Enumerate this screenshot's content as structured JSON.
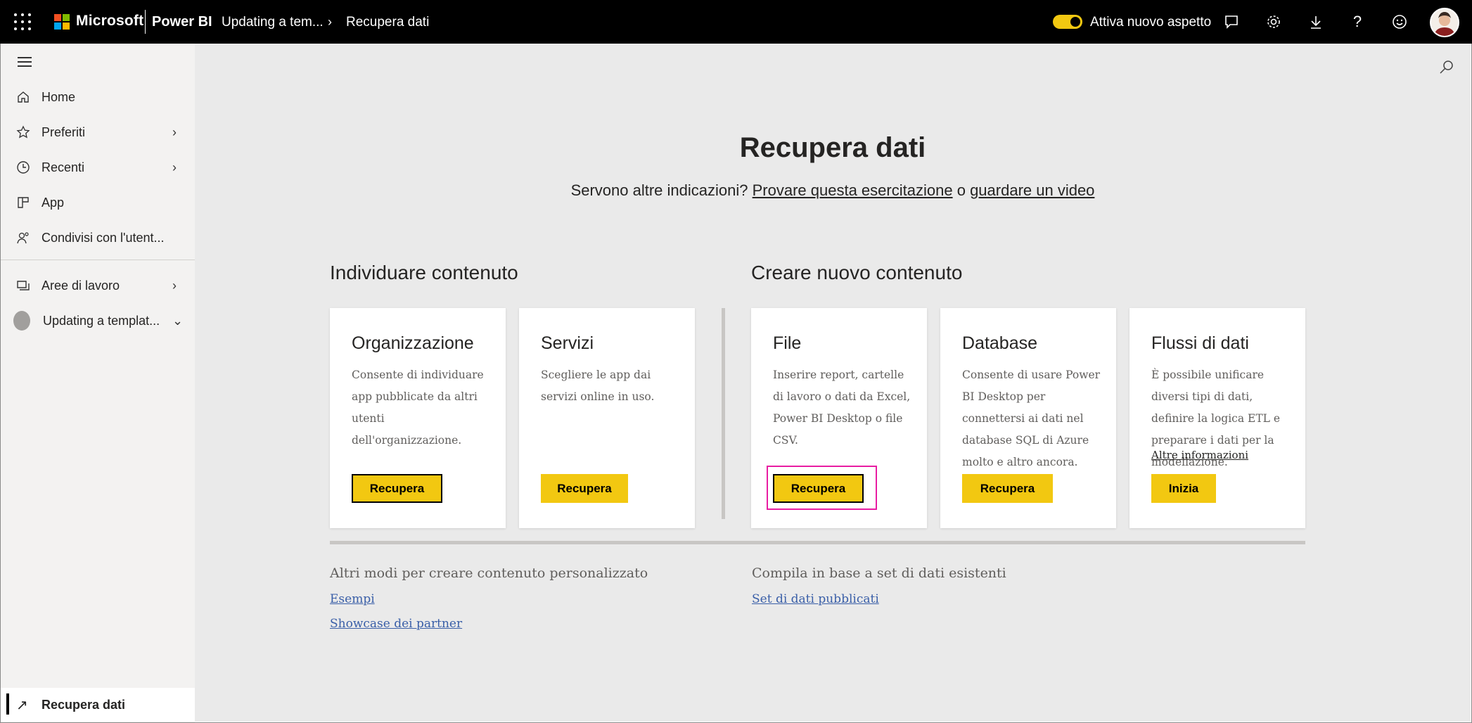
{
  "topbar": {
    "brand": "Microsoft",
    "product": "Power BI",
    "breadcrumb": [
      "Updating a tem...",
      "Recupera dati"
    ],
    "toggle_label": "Attiva nuovo aspetto",
    "toggle_on": true,
    "icons": [
      "app-launcher-icon",
      "feedback-icon",
      "settings-icon",
      "download-icon",
      "help-icon",
      "smiley-icon",
      "user-avatar"
    ]
  },
  "sidebar": {
    "items": [
      {
        "label": "Home",
        "icon": "home-icon"
      },
      {
        "label": "Preferiti",
        "icon": "star-icon",
        "chevron": "right"
      },
      {
        "label": "Recenti",
        "icon": "clock-icon",
        "chevron": "right"
      },
      {
        "label": "App",
        "icon": "apps-icon"
      },
      {
        "label": "Condivisi con l'utent...",
        "icon": "shared-icon"
      },
      {
        "label": "Aree di lavoro",
        "icon": "workspaces-icon",
        "chevron": "right"
      },
      {
        "label": "Updating a templat...",
        "icon": "workspace-badge",
        "chevron": "down"
      }
    ],
    "bottom": {
      "label": "Recupera dati",
      "icon": "arrow-up-right-icon"
    }
  },
  "main": {
    "title": "Recupera dati",
    "subtitle_prefix": "Servono altre indicazioni?",
    "subtitle_link1": "Provare questa esercitazione",
    "subtitle_mid": "o",
    "subtitle_link2": "guardare un video",
    "section_discover": "Individuare contenuto",
    "section_create": "Creare nuovo contenuto",
    "cards": [
      {
        "title": "Organizzazione",
        "desc": "Consente di individuare app pubblicate da altri utenti dell'organizzazione.",
        "button": "Recupera"
      },
      {
        "title": "Servizi",
        "desc": "Scegliere le app dai servizi online in uso.",
        "button": "Recupera"
      },
      {
        "title": "File",
        "desc": "Inserire report, cartelle di lavoro o dati da Excel, Power BI Desktop o file CSV.",
        "button": "Recupera"
      },
      {
        "title": "Database",
        "desc": "Consente di usare Power BI Desktop per connettersi ai dati nel database SQL di Azure molto e altro ancora.",
        "button": "Recupera"
      },
      {
        "title": "Flussi di dati",
        "desc": "È possibile unificare diversi tipi di dati, definire la logica ETL e preparare i dati per la modellazione.",
        "link": "Altre informazioni",
        "button": "Inizia"
      }
    ],
    "footer_left_heading": "Altri modi per creare contenuto personalizzato",
    "footer_left_links": [
      "Esempi",
      "Showcase dei partner"
    ],
    "footer_right_heading": "Compila in base a set di dati esistenti",
    "footer_right_links": [
      "Set di dati pubblicati"
    ]
  },
  "colors": {
    "accent": "#f2c811",
    "highlight": "#e81da2",
    "topbar": "#000000"
  }
}
